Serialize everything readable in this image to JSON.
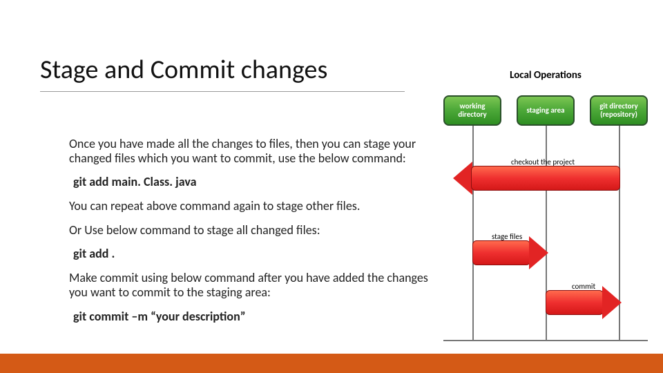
{
  "title": "Stage and Commit changes",
  "body": {
    "p1": "Once you have made all the changes to files, then you can stage your changed files which you want to commit, use the below command:",
    "cmd1": "git add main. Class. java",
    "p2": "You can repeat above command again to stage other files.",
    "p3": "Or Use below command to stage all changed files:",
    "cmd2": "git add .",
    "p4": "Make commit using below command after you have added the changes you want to commit to the staging area:",
    "cmd3": "git commit –m “your description”"
  },
  "diagram": {
    "title": "Local Operations",
    "boxes": {
      "working": "working directory",
      "staging": "staging area",
      "gitdir": "git directory (repository)"
    },
    "arrows": {
      "checkout": "checkout the project",
      "stage": "stage files",
      "commit": "commit"
    }
  }
}
